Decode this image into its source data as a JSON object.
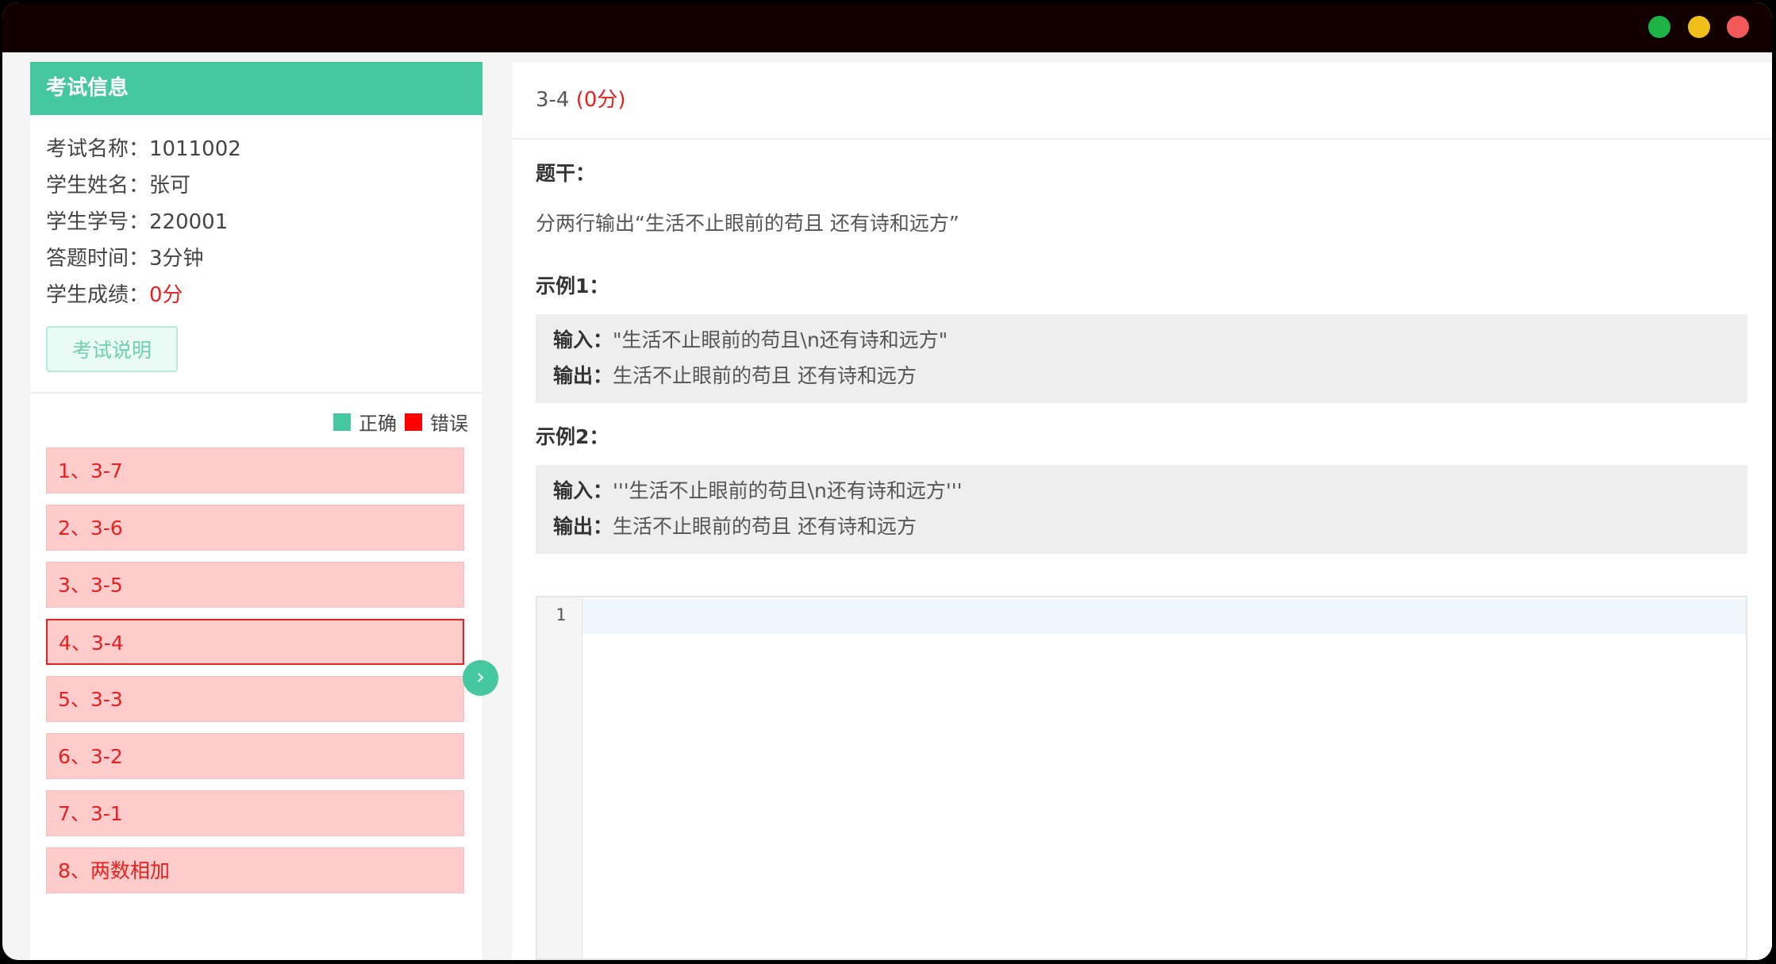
{
  "window": {
    "controls": [
      "green",
      "yellow",
      "red"
    ],
    "colors": {
      "green": "#1db445",
      "yellow": "#f1bf19",
      "red": "#f25a5a"
    }
  },
  "sidebar": {
    "header": "考试信息",
    "info": [
      {
        "label": "考试名称：",
        "value": "1011002",
        "highlight": false
      },
      {
        "label": "学生姓名：",
        "value": "张可",
        "highlight": false
      },
      {
        "label": "学生学号：",
        "value": "220001",
        "highlight": false
      },
      {
        "label": "答题时间：",
        "value": "3分钟",
        "highlight": false
      },
      {
        "label": "学生成绩：",
        "value": "0分",
        "highlight": true
      }
    ],
    "exam_desc_button": "考试说明",
    "legend": {
      "correct": "正确",
      "wrong": "错误"
    },
    "questions": [
      {
        "label": "1、3-7",
        "active": false
      },
      {
        "label": "2、3-6",
        "active": false
      },
      {
        "label": "3、3-5",
        "active": false
      },
      {
        "label": "4、3-4",
        "active": true
      },
      {
        "label": "5、3-3",
        "active": false
      },
      {
        "label": "6、3-2",
        "active": false
      },
      {
        "label": "7、3-1",
        "active": false
      },
      {
        "label": "8、两数相加",
        "active": false
      }
    ],
    "collapse_icon": "chevron-right-icon"
  },
  "main": {
    "question_title": "3-4",
    "question_score": "(0分)",
    "stem_title": "题干：",
    "stem_text": "分两行输出“生活不止眼前的苟且 还有诗和远方”",
    "examples": [
      {
        "title": "示例1：",
        "input_label": "输入：",
        "input": "\"生活不止眼前的苟且\\n还有诗和远方\"",
        "output_label": "输出：",
        "output": "生活不止眼前的苟且 还有诗和远方"
      },
      {
        "title": "示例2：",
        "input_label": "输入：",
        "input": "'''生活不止眼前的苟且\\n还有诗和远方'''",
        "output_label": "输出：",
        "output": "生活不止眼前的苟且 还有诗和远方"
      }
    ],
    "editor": {
      "line_numbers": [
        "1"
      ]
    }
  }
}
